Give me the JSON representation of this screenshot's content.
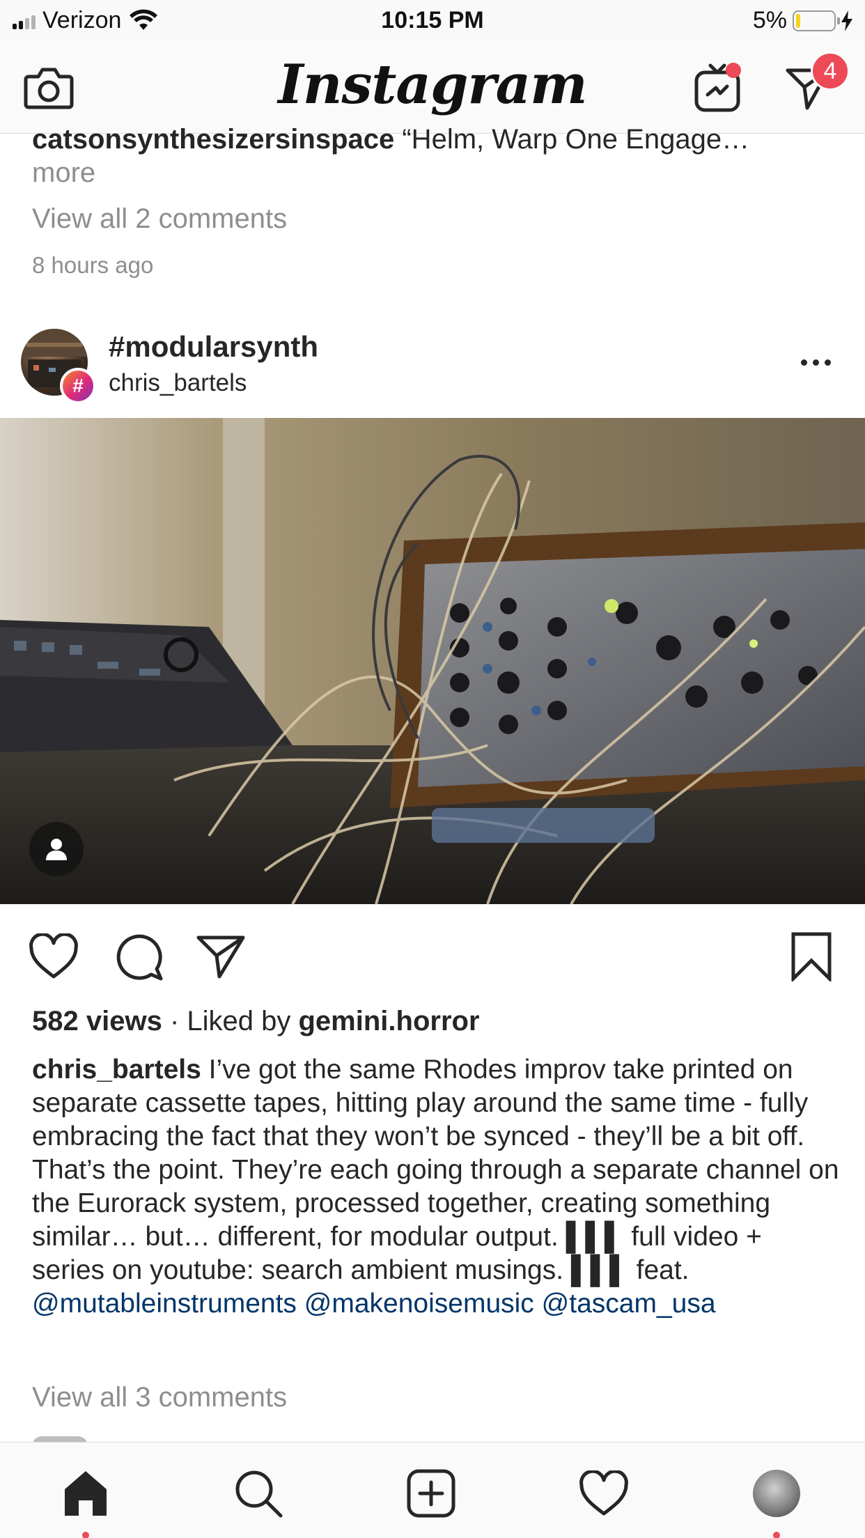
{
  "status_bar": {
    "carrier": "Verizon",
    "time": "10:15 PM",
    "battery_percent": "5%",
    "battery_level": 0.05,
    "icons": [
      "signal-icon",
      "wifi-icon",
      "battery-icon",
      "charging-bolt-icon"
    ]
  },
  "nav": {
    "logo": "Instagram",
    "direct_badge": "4",
    "icons": [
      "camera-icon",
      "igtv-icon",
      "direct-message-icon"
    ]
  },
  "previous_post": {
    "username": "catsonsynthesizersinspace",
    "caption_snippet": "“Helm, Warp One Engage…",
    "more_label": "more",
    "view_comments": "View all 2 comments",
    "time": "8 hours ago"
  },
  "post": {
    "header_title": "#modularsynth",
    "header_subtitle": "chris_bartels",
    "hashtag_badge": "#",
    "views": "582 views",
    "separator": " · ",
    "liked_by_prefix": "Liked by ",
    "liked_by_user": "gemini.horror",
    "caption_user": "chris_bartels",
    "caption_text": "I’ve got the same Rhodes improv take printed on separate cassette tapes, hitting play around the same time - fully embracing the fact that they won’t be synced - they’ll be a bit off. That’s the point. They’re each going through a separate channel on the Eurorack system, processed together, creating something similar… but… different, for modular output. ▌▌▌ full video + series on youtube: search ambient musings. ▌▌▌ feat.",
    "mentions": [
      "@mutableinstruments",
      "@makenoisemusic",
      "@tascam_usa"
    ],
    "view_comments": "View all 3 comments"
  },
  "tabs": [
    "home-icon",
    "search-icon",
    "new-post-icon",
    "activity-heart-icon",
    "profile-avatar"
  ],
  "colors": {
    "badge_red": "#ed4956",
    "link_blue": "#003569",
    "muted_gray": "#8e8e8e",
    "battery_yellow": "#f5d21e"
  }
}
